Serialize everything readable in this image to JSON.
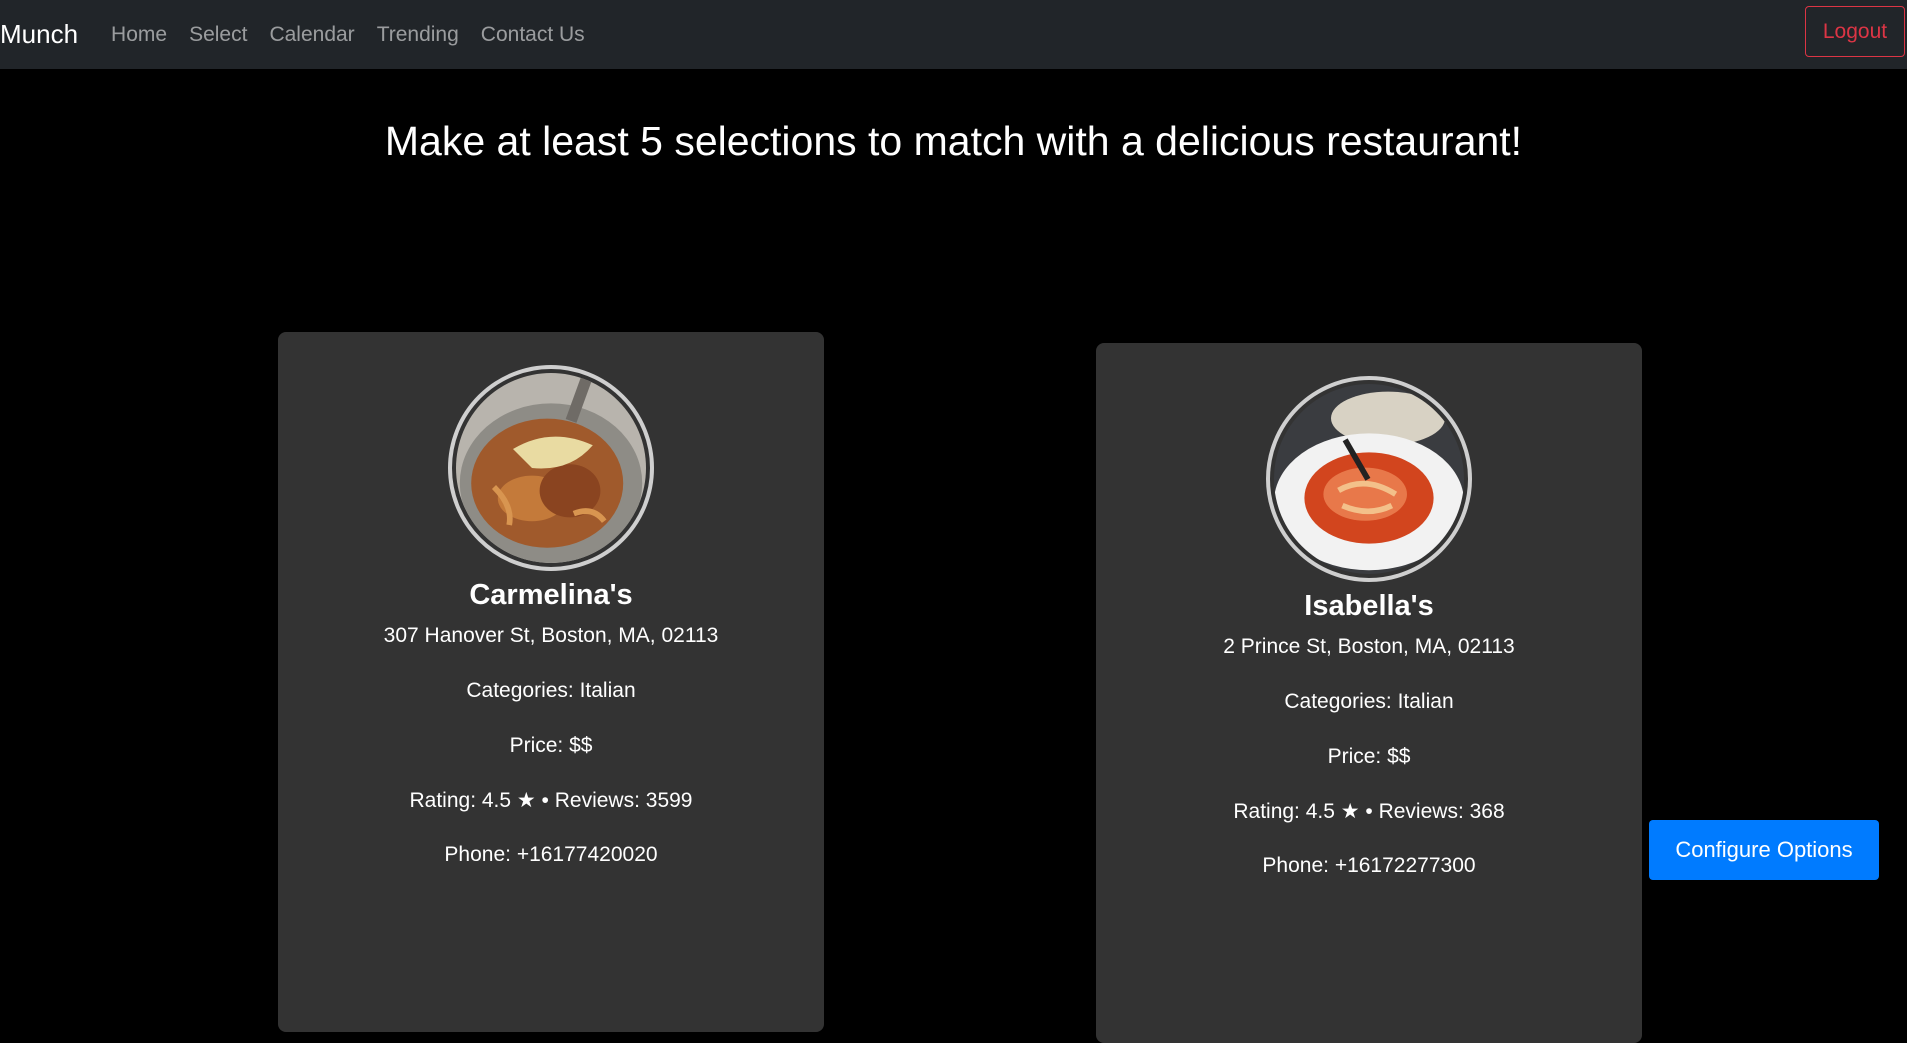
{
  "navbar": {
    "brand": "Munch",
    "links": [
      "Home",
      "Select",
      "Calendar",
      "Trending",
      "Contact Us"
    ],
    "logout_label": "Logout"
  },
  "headline": "Make at least 5 selections to match with a delicious restaurant!",
  "restaurants": [
    {
      "name": "Carmelina's",
      "address": "307 Hanover St, Boston, MA, 02113",
      "categories": "Categories: Italian",
      "price": "Price: $$",
      "rating": "Rating: 4.5 ★ • Reviews: 3599",
      "phone": "Phone: +16177420020"
    },
    {
      "name": "Isabella's",
      "address": "2 Prince St, Boston, MA, 02113",
      "categories": "Categories: Italian",
      "price": "Price: $$",
      "rating": "Rating: 4.5 ★ • Reviews: 368",
      "phone": "Phone: +16172277300"
    }
  ],
  "configure_label": "Configure Options",
  "colors": {
    "navbar_bg": "#212529",
    "page_bg": "#000000",
    "card_bg": "#333333",
    "danger": "#dc3545",
    "primary": "#007bff"
  }
}
